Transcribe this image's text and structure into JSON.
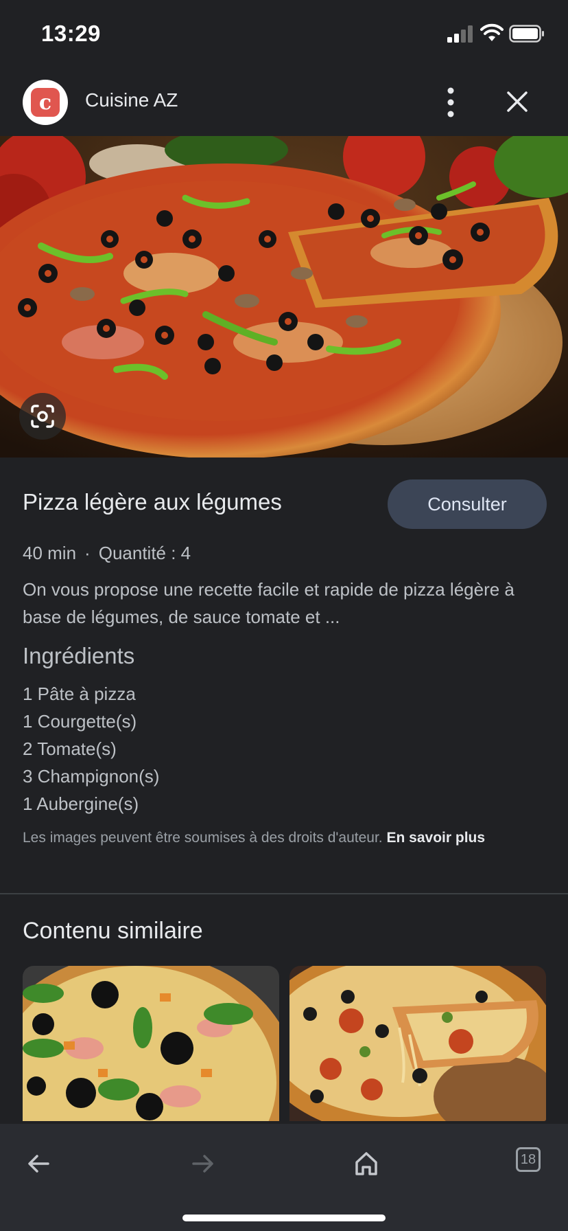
{
  "status": {
    "time": "13:29"
  },
  "header": {
    "site_name": "Cuisine AZ",
    "logo_letter": "c",
    "icons": [
      "more-vert-icon",
      "close-icon"
    ]
  },
  "recipe": {
    "title": "Pizza légère aux légumes",
    "consult_label": "Consulter",
    "duration": "40 min",
    "separator": "·",
    "quantity": "Quantité : 4",
    "description": "On vous propose une recette facile et rapide de pizza légère à base de légumes, de sauce tomate et ...",
    "ingredients_title": "Ingrédients",
    "ingredients": [
      "1 Pâte à pizza",
      "1 Courgette(s)",
      "2 Tomate(s)",
      "3 Champignon(s)",
      "1 Aubergine(s)"
    ]
  },
  "copyright": {
    "text": "Les images peuvent être soumises à des droits d'auteur. ",
    "link": "En savoir plus"
  },
  "similar": {
    "title": "Contenu similaire"
  },
  "bottombar": {
    "tab_count": "18",
    "icons": [
      "back-icon",
      "forward-icon",
      "home-icon",
      "tabs-icon"
    ]
  },
  "colors": {
    "background": "#202124",
    "button_bg": "#3c4556",
    "bar_bg": "#2a2c31"
  }
}
